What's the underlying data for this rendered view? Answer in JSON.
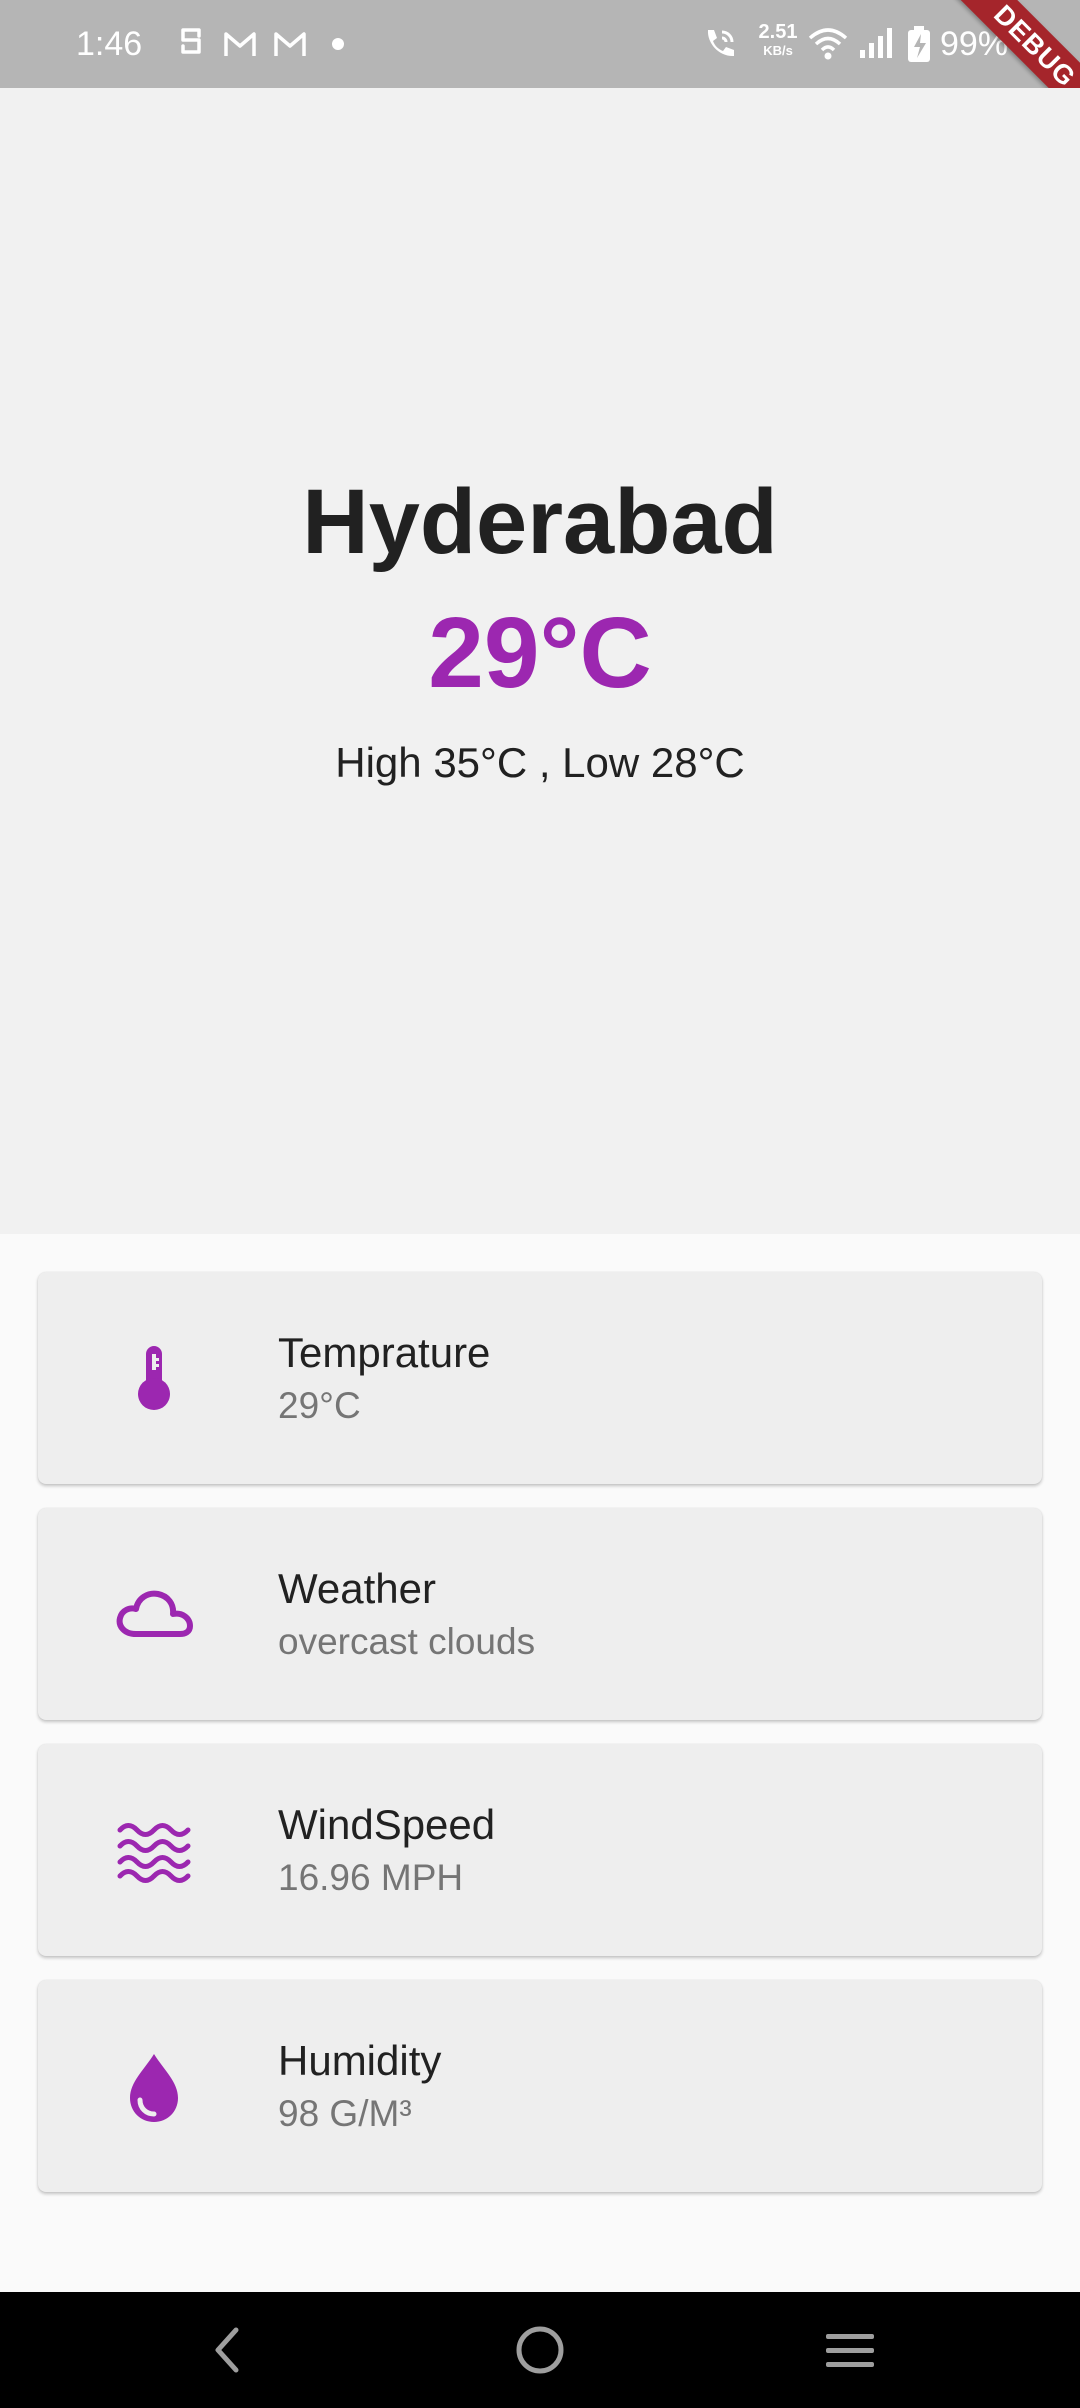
{
  "status_bar": {
    "time": "1:46",
    "notification_icons": [
      "s-shield-icon",
      "gmail-icon",
      "gmail-icon",
      "dot-icon"
    ],
    "net_speed_value": "2.51",
    "net_speed_unit": "KB/s",
    "battery": "99%"
  },
  "debug_banner": "DEBUG",
  "location": {
    "city": "Hyderabad",
    "temperature": "29°C",
    "high_low": "High 35°C , Low 28°C"
  },
  "cards": [
    {
      "icon": "thermometer-icon",
      "title": "Temprature",
      "value": "29°C"
    },
    {
      "icon": "cloud-icon",
      "title": "Weather",
      "value": "overcast clouds"
    },
    {
      "icon": "wind-waves-icon",
      "title": "WindSpeed",
      "value": "16.96 MPH"
    },
    {
      "icon": "water-drop-icon",
      "title": "Humidity",
      "value": "98 G/M³"
    }
  ],
  "colors": {
    "accent": "#9c27b0",
    "header_bg": "#f1f1f1",
    "card_bg": "#eeeeee",
    "status_bar_bg": "#b5b5b5",
    "debug_banner": "#a5252b"
  },
  "nav_bar": {
    "buttons": [
      "back-icon",
      "home-icon",
      "recents-menu-icon"
    ]
  }
}
